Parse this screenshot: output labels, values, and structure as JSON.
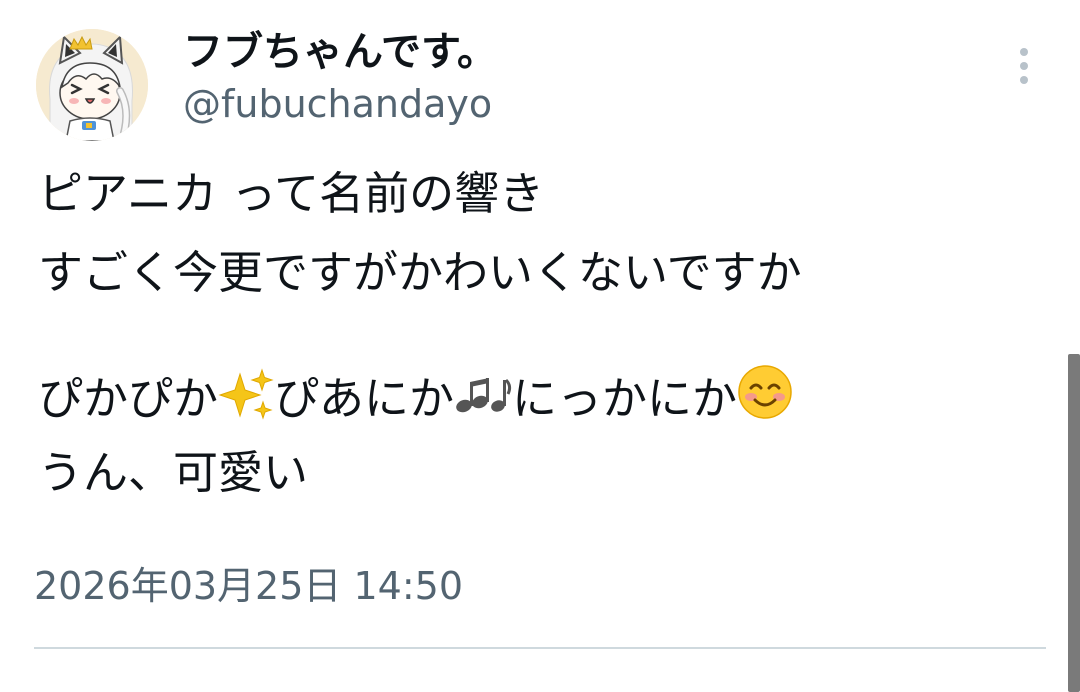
{
  "author": {
    "display_name": "フブちゃんです。",
    "handle": "@fubuchandayo",
    "avatar_icon": "fox-girl-avatar"
  },
  "more_icon": "more-vertical-icon",
  "tweet": {
    "line1": "ピアニカ って名前の響き",
    "line2": "すごく今更ですがかわいくないですか",
    "line3": [
      {
        "type": "text",
        "value": "ぴかぴか"
      },
      {
        "type": "emoji",
        "icon": "sparkles-emoji"
      },
      {
        "type": "text",
        "value": "ぴあにか"
      },
      {
        "type": "emoji",
        "icon": "notes-emoji"
      },
      {
        "type": "text",
        "value": "にっかにか"
      },
      {
        "type": "emoji",
        "icon": "smiling-face-emoji"
      }
    ],
    "line4": "うん、可愛い"
  },
  "timestamp": "2026年03月25日 14:50",
  "colors": {
    "text": "#0f1419",
    "secondary": "#536471",
    "divider": "#cfd9de",
    "more_dots": "#b8c2ca"
  }
}
